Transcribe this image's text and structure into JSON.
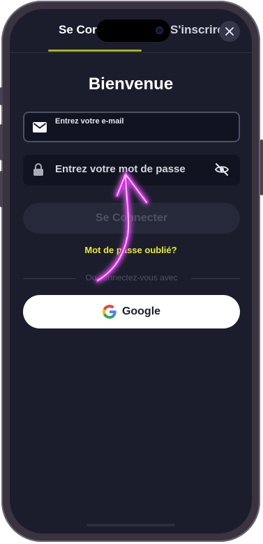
{
  "tabs": {
    "login_label": "Se Connecter",
    "signup_label": "S'inscrire"
  },
  "header": {
    "title": "Bienvenue"
  },
  "form": {
    "email_placeholder": "Entrez votre e-mail",
    "password_placeholder": "Entrez votre mot de passe",
    "login_button": "Se Connecter",
    "forgot_password": "Mot de passe oublié?",
    "divider_text": "Ou connectez-vous avec",
    "google_button": "Google"
  },
  "icons": {
    "close": "close-icon",
    "email": "mail-icon",
    "password": "lock-icon",
    "visibility": "eye-off-icon",
    "google": "google-logo",
    "annotation": "arrow-icon"
  },
  "colors": {
    "background": "#1b1d2c",
    "accent": "#a7b21e",
    "forgot_link": "#e8ee1c",
    "annotation_arrow": "#e040fb"
  }
}
